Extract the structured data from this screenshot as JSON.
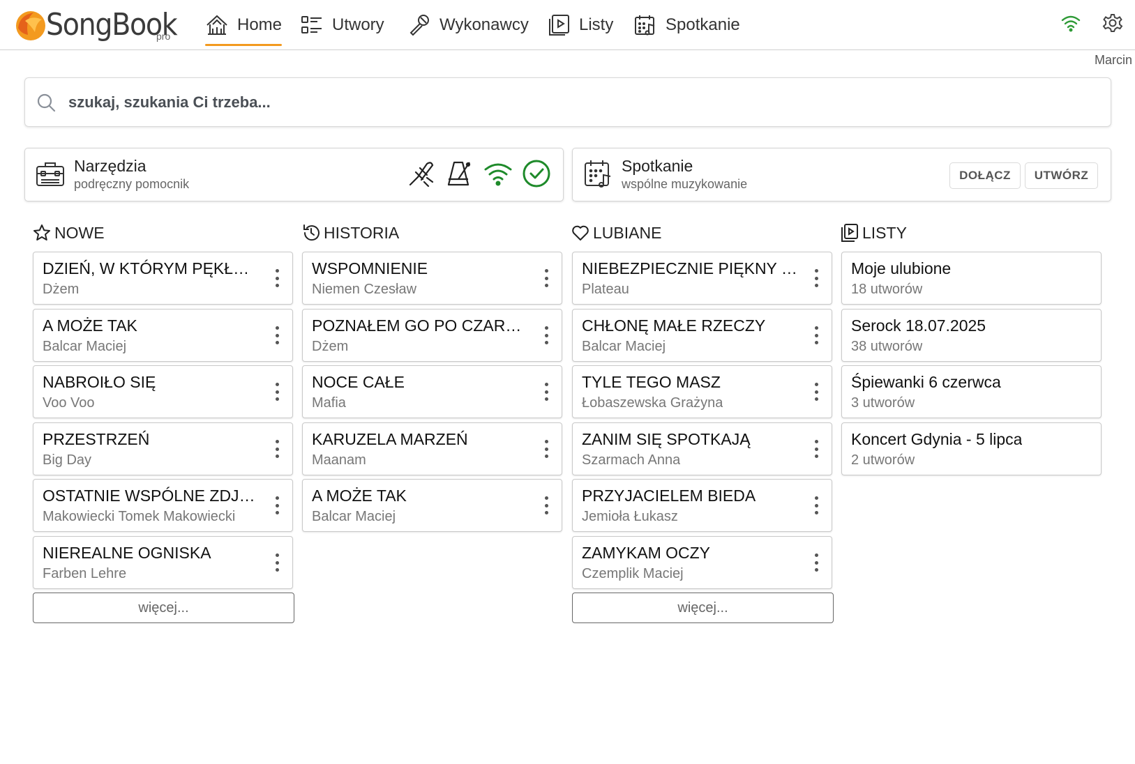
{
  "app": {
    "name": "SongBook",
    "edition": "pro",
    "user": "Marcin"
  },
  "nav": [
    {
      "label": "Home",
      "icon": "home-icon",
      "active": true
    },
    {
      "label": "Utwory",
      "icon": "list-icon"
    },
    {
      "label": "Wykonawcy",
      "icon": "microphone-icon"
    },
    {
      "label": "Listy",
      "icon": "playlist-icon"
    },
    {
      "label": "Spotkanie",
      "icon": "calendar-music-icon"
    }
  ],
  "search": {
    "placeholder": "szukaj, szukania Ci trzeba..."
  },
  "tools": {
    "title": "Narzędzia",
    "subtitle": "podręczny pomocnik"
  },
  "meeting": {
    "title": "Spotkanie",
    "subtitle": "wspólne muzykowanie",
    "join_label": "DOŁĄCZ",
    "create_label": "UTWÓRZ"
  },
  "colors": {
    "accent": "#f39a1f",
    "green": "#1e8a2a"
  },
  "columns": {
    "nowe": {
      "title": "NOWE",
      "items": [
        {
          "title": "DZIEŃ, W KTÓRYM PĘKŁO NIEBO",
          "subtitle": "Dżem"
        },
        {
          "title": "A MOŻE TAK",
          "subtitle": "Balcar Maciej"
        },
        {
          "title": "NABROIŁO SIĘ",
          "subtitle": "Voo Voo"
        },
        {
          "title": "PRZESTRZEŃ",
          "subtitle": "Big Day"
        },
        {
          "title": "OSTATNIE WSPÓLNE ZDJĘCIE",
          "subtitle": "Makowiecki Tomek Makowiecki"
        },
        {
          "title": "NIEREALNE OGNISKA",
          "subtitle": "Farben Lehre"
        }
      ],
      "more_label": "więcej..."
    },
    "historia": {
      "title": "HISTORIA",
      "items": [
        {
          "title": "WSPOMNIENIE",
          "subtitle": "Niemen Czesław"
        },
        {
          "title": "POZNAŁEM GO PO CZARNYM KAPELUSZU",
          "subtitle": "Dżem"
        },
        {
          "title": "NOCE CAŁE",
          "subtitle": "Mafia"
        },
        {
          "title": "KARUZELA MARZEŃ",
          "subtitle": "Maanam"
        },
        {
          "title": "A MOŻE TAK",
          "subtitle": "Balcar Maciej"
        }
      ]
    },
    "lubiane": {
      "title": "LUBIANE",
      "items": [
        {
          "title": "NIEBEZPIECZNIE PIĘKNY ŚWIAT",
          "subtitle": "Plateau"
        },
        {
          "title": "CHŁONĘ MAŁE RZECZY",
          "subtitle": "Balcar Maciej"
        },
        {
          "title": "TYLE TEGO MASZ",
          "subtitle": "Łobaszewska Grażyna"
        },
        {
          "title": "ZANIM SIĘ SPOTKAJĄ",
          "subtitle": "Szarmach Anna"
        },
        {
          "title": "PRZYJACIELEM BIEDA",
          "subtitle": "Jemioła Łukasz"
        },
        {
          "title": "ZAMYKAM OCZY",
          "subtitle": "Czemplik Maciej"
        }
      ],
      "more_label": "więcej..."
    },
    "listy": {
      "title": "LISTY",
      "items": [
        {
          "title": "Moje ulubione",
          "subtitle": "18 utworów"
        },
        {
          "title": "Serock 18.07.2025",
          "subtitle": "38 utworów"
        },
        {
          "title": "Śpiewanki 6 czerwca",
          "subtitle": "3 utworów"
        },
        {
          "title": "Koncert Gdynia - 5 lipca",
          "subtitle": "2 utworów"
        }
      ]
    }
  }
}
